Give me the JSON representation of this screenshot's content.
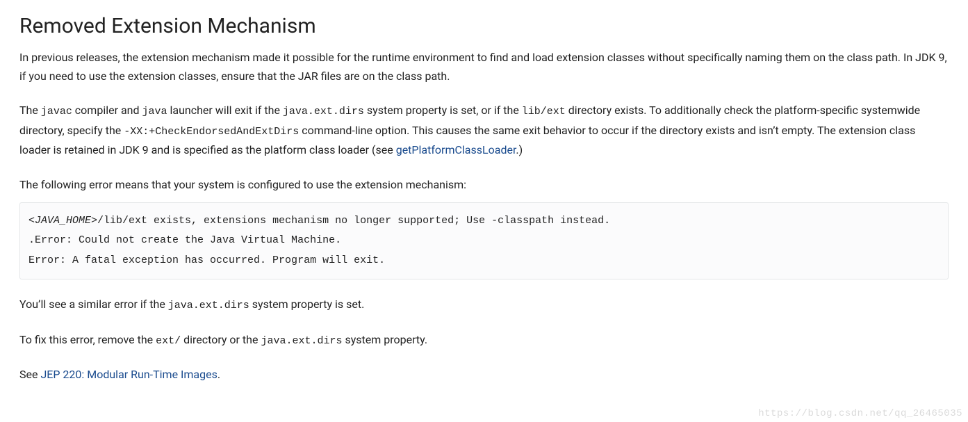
{
  "title": "Removed Extension Mechanism",
  "p1": "In previous releases, the extension mechanism made it possible for the runtime environment to find and load extension classes without specifically naming them on the class path. In JDK 9, if you need to use the extension classes, ensure that the JAR files are on the class path.",
  "p2": {
    "t1": "The ",
    "c1": "javac",
    "t2": " compiler and ",
    "c2": "java",
    "t3": " launcher will exit if the ",
    "c3": "java.ext.dirs",
    "t4": " system property is set, or if the ",
    "c4": "lib/ext",
    "t5": " directory exists. To additionally check the platform-specific systemwide directory, specify the ",
    "c5": "-XX:+CheckEndorsedAndExtDirs",
    "t6": " command-line option. This causes the same exit behavior to occur if the directory exists and isn’t empty. The extension class loader is retained in JDK 9 and is specified as the platform class loader (see ",
    "link": "getPlatformClassLoader",
    "t7": ".)"
  },
  "p3": "The following error means that your system is configured to use the extension mechanism:",
  "code": {
    "ital": "<JAVA_HOME>",
    "rest1": "/lib/ext exists, extensions mechanism no longer supported; Use -classpath instead.",
    "line2": ".Error: Could not create the Java Virtual Machine.",
    "line3": "Error: A fatal exception has occurred. Program will exit."
  },
  "p4": {
    "t1": "You’ll see a similar error if the ",
    "c1": "java.ext.dirs",
    "t2": " system property is set."
  },
  "p5": {
    "t1": "To fix this error, remove the ",
    "c1": "ext/",
    "t2": " directory or the ",
    "c2": "java.ext.dirs",
    "t3": " system property."
  },
  "p6": {
    "t1": "See ",
    "link": "JEP 220: Modular Run-Time Images",
    "t2": "."
  },
  "watermark": "https://blog.csdn.net/qq_26465035"
}
